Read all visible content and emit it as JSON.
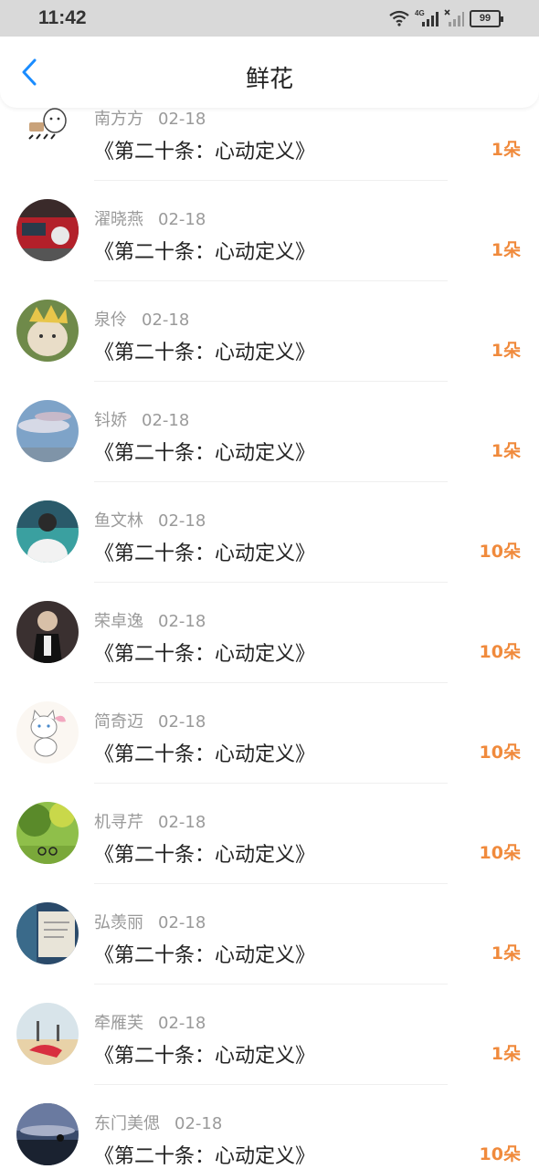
{
  "status_bar": {
    "time": "11:42",
    "network": "4G",
    "battery": "99"
  },
  "header": {
    "title": "鲜花",
    "back_icon": "chevron-left-icon"
  },
  "colors": {
    "accent_blue": "#1a8cff",
    "amount_orange": "#f08a3c",
    "meta_gray": "#9a9a9a"
  },
  "items": [
    {
      "name": "南方方",
      "date": "02-18",
      "title": "《第二十条：心动定义》",
      "amount": "1朵"
    },
    {
      "name": "濯晓燕",
      "date": "02-18",
      "title": "《第二十条：心动定义》",
      "amount": "1朵"
    },
    {
      "name": "泉伶",
      "date": "02-18",
      "title": "《第二十条：心动定义》",
      "amount": "1朵"
    },
    {
      "name": "钭娇",
      "date": "02-18",
      "title": "《第二十条：心动定义》",
      "amount": "1朵"
    },
    {
      "name": "鱼文林",
      "date": "02-18",
      "title": "《第二十条：心动定义》",
      "amount": "10朵"
    },
    {
      "name": "荣卓逸",
      "date": "02-18",
      "title": "《第二十条：心动定义》",
      "amount": "10朵"
    },
    {
      "name": "简奇迈",
      "date": "02-18",
      "title": "《第二十条：心动定义》",
      "amount": "10朵"
    },
    {
      "name": "机寻芹",
      "date": "02-18",
      "title": "《第二十条：心动定义》",
      "amount": "10朵"
    },
    {
      "name": "弘羡丽",
      "date": "02-18",
      "title": "《第二十条：心动定义》",
      "amount": "1朵"
    },
    {
      "name": "牵雁芙",
      "date": "02-18",
      "title": "《第二十条：心动定义》",
      "amount": "1朵"
    },
    {
      "name": "东门美偲",
      "date": "02-18",
      "title": "《第二十条：心动定义》",
      "amount": "10朵"
    }
  ]
}
